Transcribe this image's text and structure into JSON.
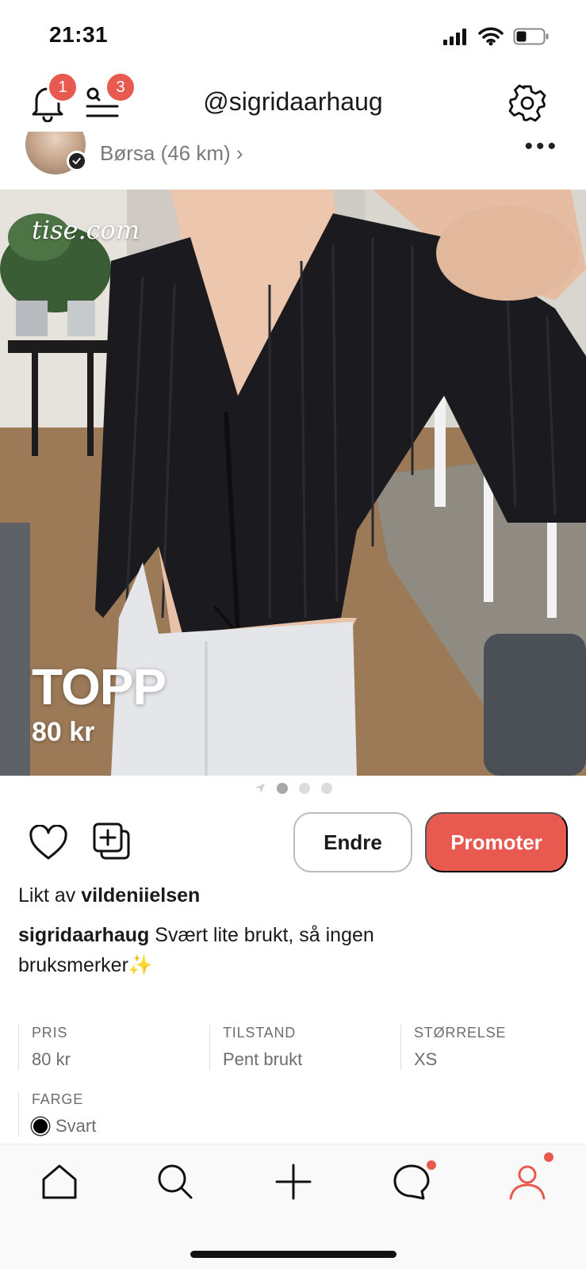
{
  "status_bar": {
    "time": "21:31"
  },
  "header": {
    "title": "@sigridaarhaug",
    "notification_count": "1",
    "menu_count": "3"
  },
  "seller": {
    "location": "Børsa (46 km) ›"
  },
  "product": {
    "watermark": "tise.com",
    "title": "TOPP",
    "price": "80 kr"
  },
  "actions": {
    "edit_label": "Endre",
    "promote_label": "Promoter"
  },
  "liked_by": {
    "prefix": "Likt av",
    "user": "vildeniielsen"
  },
  "description": {
    "user": "sigridaarhaug",
    "text": "Svært lite brukt, så ingen bruksmerker✨"
  },
  "attributes": {
    "price": {
      "label": "PRIS",
      "value": "80 kr"
    },
    "condition": {
      "label": "TILSTAND",
      "value": "Pent brukt"
    },
    "size": {
      "label": "STØRRELSE",
      "value": "XS"
    },
    "color": {
      "label": "FARGE",
      "value": "Svart",
      "swatch": "#000000"
    }
  },
  "colors": {
    "accent": "#e8594f",
    "text": "#1a1a1a",
    "muted": "#7a7a7a"
  },
  "bottom_nav": {
    "items": [
      "home-icon",
      "search-icon",
      "add-icon",
      "chat-icon",
      "profile-icon"
    ]
  }
}
